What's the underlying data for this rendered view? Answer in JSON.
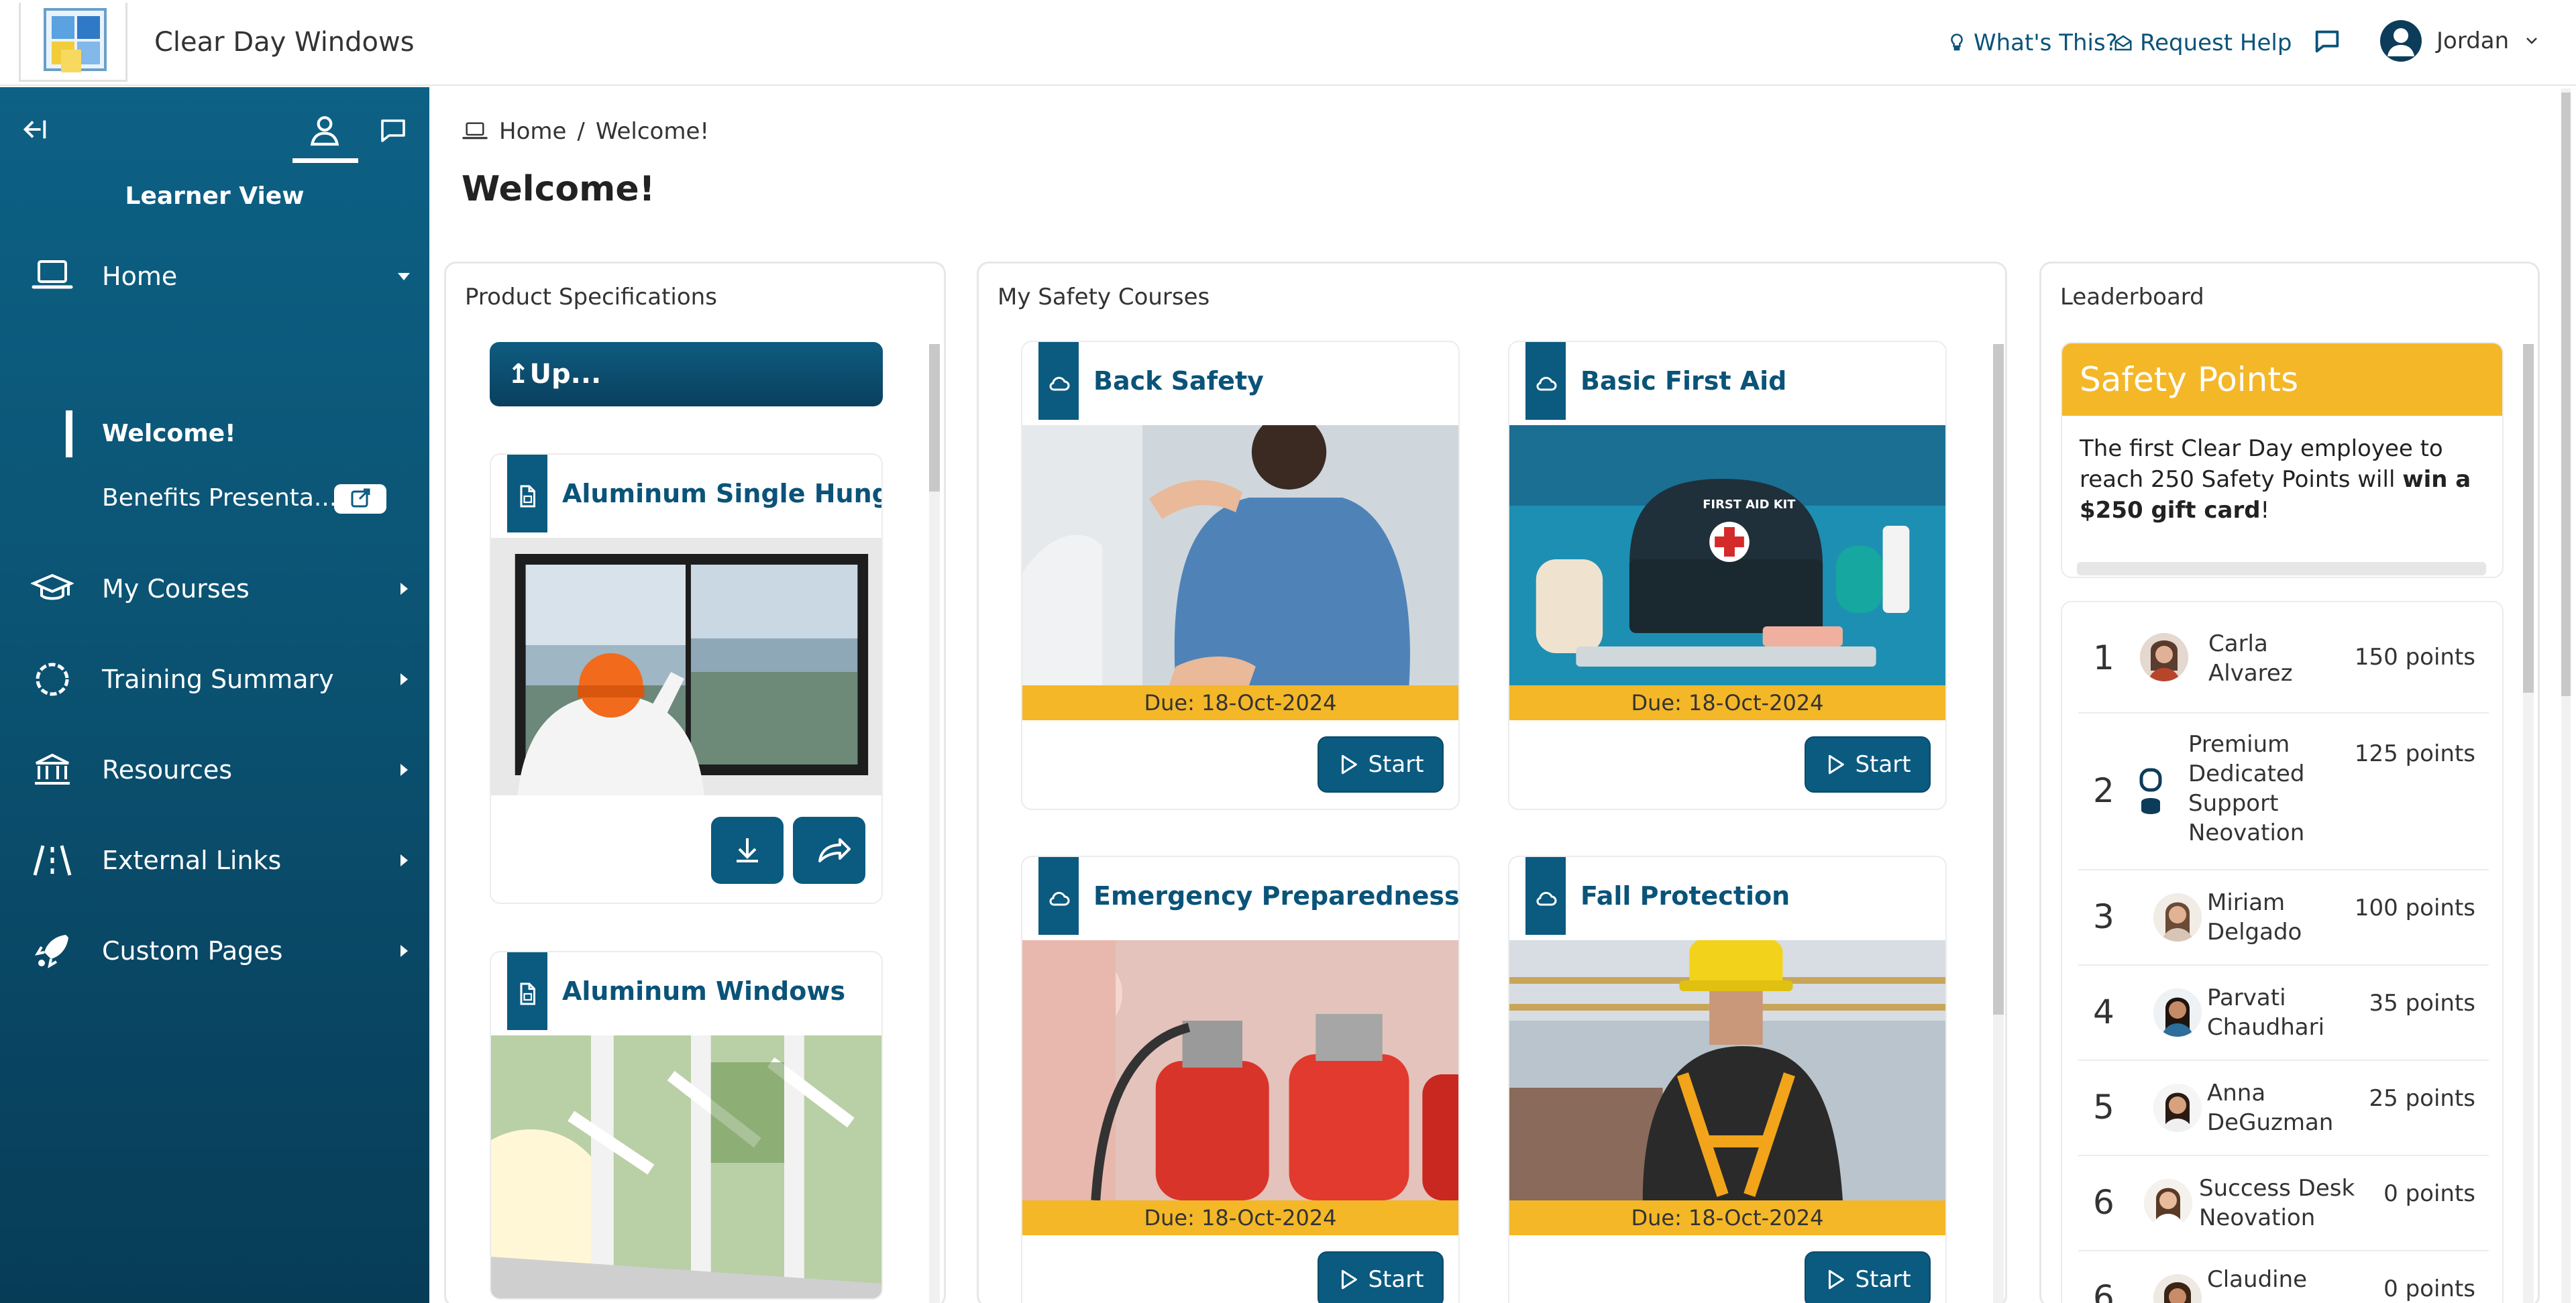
{
  "header": {
    "app_title": "Clear Day Windows",
    "whats_this": "What's This?",
    "request_help": "Request Help",
    "user_name": "Jordan"
  },
  "sidebar": {
    "view_label": "Learner View",
    "items": [
      {
        "label": "Home",
        "icon": "laptop-icon",
        "expanded": true
      },
      {
        "label": "My Courses",
        "icon": "graduation-cap-icon"
      },
      {
        "label": "Training Summary",
        "icon": "circle-dashed-icon"
      },
      {
        "label": "Resources",
        "icon": "bank-icon"
      },
      {
        "label": "External Links",
        "icon": "road-icon"
      },
      {
        "label": "Custom Pages",
        "icon": "rocket-icon"
      }
    ],
    "sub_items": [
      {
        "label": "Welcome!"
      },
      {
        "label": "Benefits Presenta..."
      }
    ]
  },
  "breadcrumb": {
    "home": "Home",
    "separator": "/",
    "current": "Welcome!"
  },
  "page_title": "Welcome!",
  "product_specs": {
    "title": "Product Specifications",
    "up_button": "↥Up...",
    "cards": [
      {
        "title": "Aluminum Single Hung ..."
      },
      {
        "title": "Aluminum Windows"
      }
    ]
  },
  "safety_courses": {
    "title": "My Safety Courses",
    "start_label": "Start",
    "courses": [
      {
        "title": "Back Safety",
        "due": "Due: 18-Oct-2024"
      },
      {
        "title": "Basic First Aid",
        "due": "Due: 18-Oct-2024"
      },
      {
        "title": "Emergency Preparedness &...",
        "due": "Due: 18-Oct-2024"
      },
      {
        "title": "Fall Protection",
        "due": "Due: 18-Oct-2024"
      }
    ],
    "kit_label": "FIRST AID KIT"
  },
  "leaderboard": {
    "title": "Leaderboard",
    "banner": "Safety Points Leaderboard",
    "desc_pre": "The first Clear Day employee to reach 250 Safety Points will ",
    "desc_bold": "win a $250 gift card",
    "desc_post": "!",
    "rows": [
      {
        "rank": "1",
        "name_1": "Carla",
        "name_2": "Alvarez",
        "points": "150 points"
      },
      {
        "rank": "2",
        "name_1": "Premium",
        "name_2": "Dedicated",
        "name_3": "Support",
        "name_4": "Neovation",
        "points": "125 points"
      },
      {
        "rank": "3",
        "name_1": "Miriam",
        "name_2": "Delgado",
        "points": "100 points"
      },
      {
        "rank": "4",
        "name_1": "Parvati",
        "name_2": "Chaudhari",
        "points": "35 points"
      },
      {
        "rank": "5",
        "name_1": "Anna",
        "name_2": "DeGuzman",
        "points": "25 points"
      },
      {
        "rank": "6",
        "name_1": "Success Desk",
        "name_2": "Neovation",
        "points": "0 points"
      },
      {
        "rank": "6",
        "name_1": "Claudine",
        "name_2": "",
        "points": "0 points"
      }
    ]
  },
  "colors": {
    "brand_blue": "#0b5a80",
    "accent_yellow": "#f4b728",
    "sidebar_dark": "#073c57"
  }
}
